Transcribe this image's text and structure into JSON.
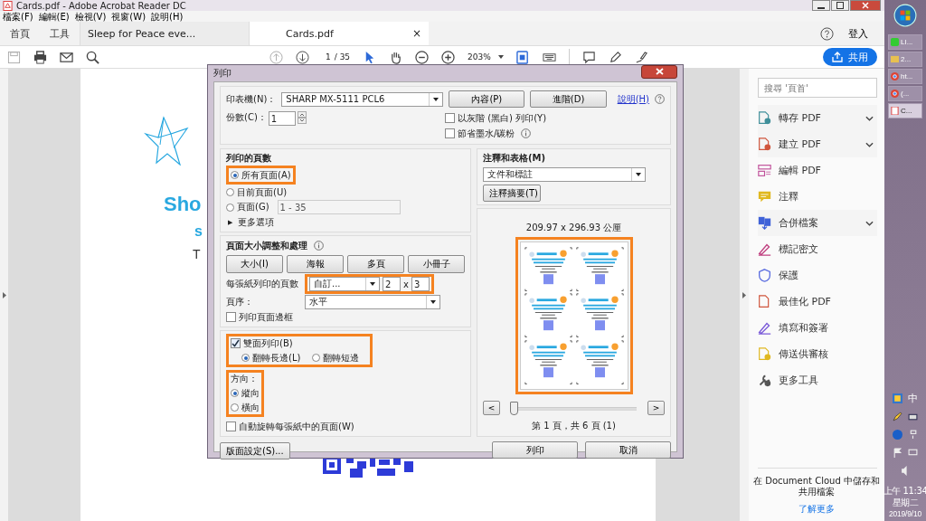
{
  "app_window": {
    "title": "Cards.pdf - Adobe Acrobat Reader DC"
  },
  "menu": [
    "檔案(F)",
    "編輯(E)",
    "檢視(V)",
    "視窗(W)",
    "說明(H)"
  ],
  "nav": [
    "首頁",
    "工具"
  ],
  "tabs": [
    {
      "label": "Sleep for Peace eve...",
      "selected": false
    },
    {
      "label": "Cards.pdf",
      "selected": true,
      "close": "×"
    }
  ],
  "sign_in": "登入",
  "toolbar": {
    "page": "1",
    "page_count": "/ 35",
    "zoom": "203%",
    "share": "共用"
  },
  "document": {
    "texts": [
      "Sho",
      "s",
      "T"
    ]
  },
  "print_dialog": {
    "title": "列印",
    "printer": {
      "label": "印表機(N)：",
      "value": "SHARP MX-5111  PCL6"
    },
    "top_buttons": [
      "內容(P)",
      "進階(D)"
    ],
    "help_link": "說明(H)",
    "copies": {
      "label": "份數(C)：",
      "value": "1"
    },
    "options": [
      {
        "label": "以灰階 (黑白) 列印(Y)",
        "checked": false,
        "info": false
      },
      {
        "label": "節省墨水/碳粉",
        "checked": false,
        "info": true
      }
    ],
    "pages": {
      "title": "列印的頁數",
      "choices": [
        {
          "label": "所有頁面(A)",
          "selected": true,
          "highlighted": true
        },
        {
          "label": "目前頁面(U)",
          "selected": false,
          "highlighted": false
        },
        {
          "label": "頁面(G)",
          "selected": false,
          "highlighted": false
        }
      ],
      "range": {
        "value": "1 - 35",
        "disabled": true
      },
      "more": {
        "arrow": "▶",
        "label": "更多選項"
      }
    },
    "sizing": {
      "title": "頁面大小調整和處理",
      "modes": [
        "大小(I)",
        "海報",
        "多頁",
        "小冊子"
      ],
      "per_sheet": {
        "label": "每張紙列印的頁數",
        "value": "自訂...",
        "columns": "2",
        "by": "x",
        "rows": "3",
        "highlighted": true
      },
      "order": {
        "label": "頁序：",
        "value": "水平"
      },
      "border": {
        "label": "列印頁面邊框",
        "checked": false
      },
      "duplex": {
        "label": "雙面列印(B)",
        "checked": true,
        "highlighted": true,
        "flips": [
          {
            "label": "翻轉長邊(L)",
            "selected": true
          },
          {
            "label": "翻轉短邊",
            "selected": false
          }
        ]
      },
      "orientation": {
        "label": "方向：",
        "highlighted": true,
        "choices": [
          {
            "label": "縱向",
            "selected": true
          },
          {
            "label": "橫向",
            "selected": false
          }
        ]
      },
      "auto_rotate": {
        "label": "自動旋轉每張紙中的頁面(W)",
        "checked": false
      }
    },
    "page_setup": "版面設定(S)...",
    "comments": {
      "title": "注釋和表格(M)",
      "value": "文件和標註",
      "summary": "注釋摘要(T)"
    },
    "preview": {
      "size": "209.97 x 296.93 公厘",
      "highlighted": true,
      "prev": "<",
      "next": ">",
      "slider": {
        "level": 0
      },
      "page_info": "第 1 頁，共 6 頁 (1)"
    },
    "actions": [
      "列印",
      "取消"
    ]
  },
  "tools_panel": {
    "search_placeholder": "搜尋 '頁首'",
    "tools": [
      {
        "label": "轉存 PDF",
        "kind": "export",
        "expandable": true
      },
      {
        "label": "建立 PDF",
        "kind": "create",
        "expandable": true
      },
      {
        "label": "編輯 PDF",
        "kind": "edit",
        "expandable": false
      },
      {
        "label": "注釋",
        "kind": "comment",
        "expandable": false
      },
      {
        "label": "合併檔案",
        "kind": "combine",
        "expandable": true
      },
      {
        "label": "標記密文",
        "kind": "redact",
        "expandable": false
      },
      {
        "label": "保護",
        "kind": "protect",
        "expandable": false
      },
      {
        "label": "最佳化 PDF",
        "kind": "optimize",
        "expandable": false
      },
      {
        "label": "填寫和簽署",
        "kind": "sign",
        "expandable": false
      },
      {
        "label": "傳送供審核",
        "kind": "review",
        "expandable": false
      },
      {
        "label": "更多工具",
        "kind": "more",
        "expandable": false
      }
    ],
    "cloud_text": "在 Document Cloud 中儲存和共用檔案",
    "learn_more": "了解更多"
  },
  "taskbar": {
    "windows": [
      {
        "label": "LI...",
        "kind": "chat",
        "selected": false
      },
      {
        "label": "2...",
        "kind": "folder",
        "selected": false
      },
      {
        "label": "ht...",
        "kind": "browser",
        "selected": false
      },
      {
        "label": "(...",
        "kind": "browser",
        "selected": false
      },
      {
        "label": "C...",
        "kind": "pdf",
        "selected": true
      }
    ],
    "ime": "中",
    "time": "上午 11:34",
    "weekday": "星期二",
    "date": "2019/9/10"
  }
}
